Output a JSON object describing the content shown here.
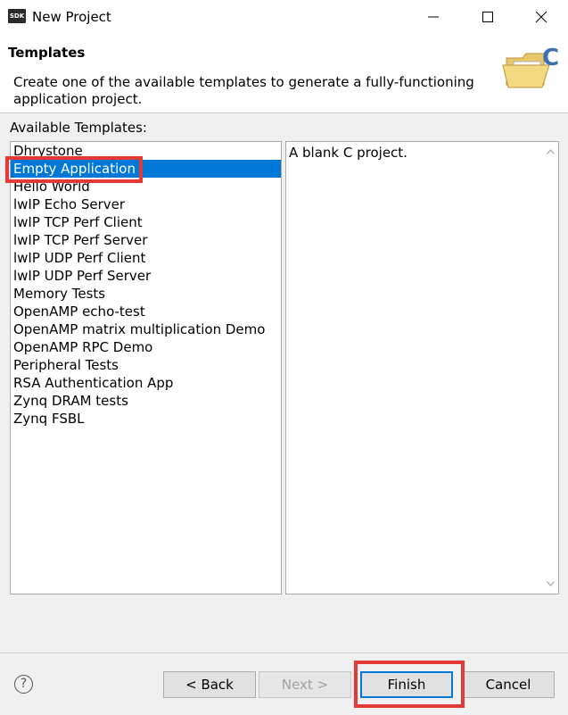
{
  "window": {
    "app_icon_text": "SDK",
    "title": "New Project"
  },
  "header": {
    "title": "Templates",
    "description": "Create one of the available templates to generate a fully-functioning application project."
  },
  "templates": {
    "label": "Available Templates:",
    "items": [
      "Dhrystone",
      "Empty Application",
      "Hello World",
      "lwIP Echo Server",
      "lwIP TCP Perf Client",
      "lwIP TCP Perf Server",
      "lwIP UDP Perf Client",
      "lwIP UDP Perf Server",
      "Memory Tests",
      "OpenAMP echo-test",
      "OpenAMP matrix multiplication Demo",
      "OpenAMP RPC Demo",
      "Peripheral Tests",
      "RSA Authentication App",
      "Zynq DRAM tests",
      "Zynq FSBL"
    ],
    "selected": "Empty Application"
  },
  "description_panel": {
    "text": "A blank C project."
  },
  "footer": {
    "help_symbol": "?",
    "back_label": "< Back",
    "next_label": "Next >",
    "finish_label": "Finish",
    "cancel_label": "Cancel"
  },
  "colors": {
    "selection": "#0078d7",
    "highlight": "#e53935"
  }
}
